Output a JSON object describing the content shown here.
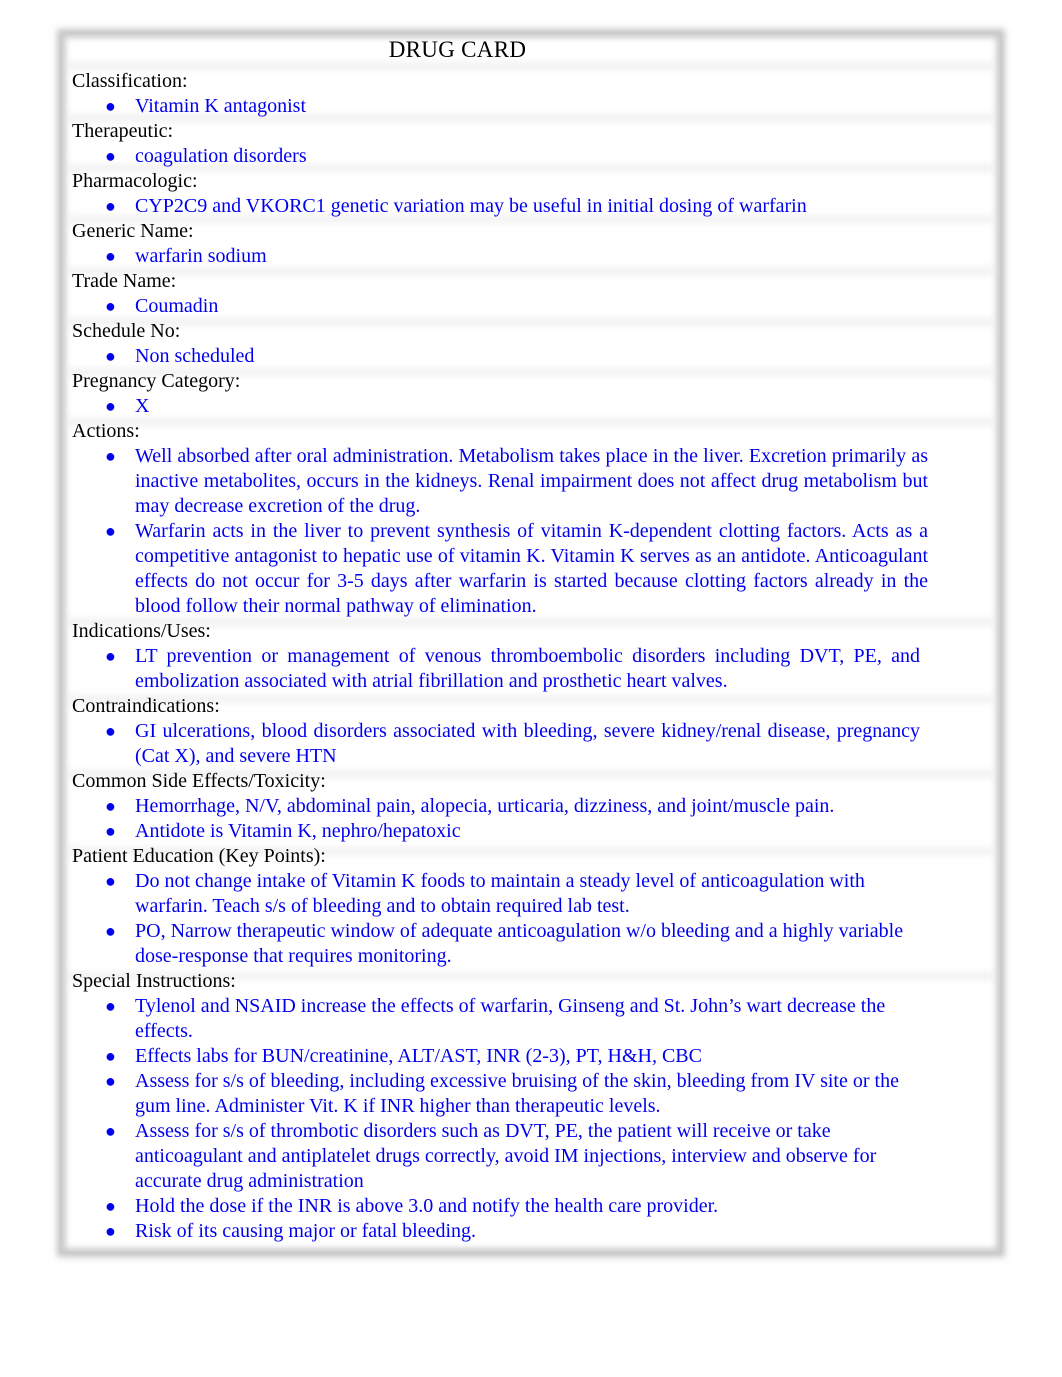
{
  "title": "DRUG CARD",
  "sections": [
    {
      "label": "Classification:",
      "items": [
        "Vitamin K antagonist"
      ]
    },
    {
      "label": "Therapeutic:",
      "items": [
        "coagulation disorders"
      ]
    },
    {
      "label": "Pharmacologic:",
      "items": [
        "CYP2C9 and VKORC1 genetic variation may be useful in initial dosing of warfarin"
      ]
    },
    {
      "label": "Generic Name:",
      "items": [
        "warfarin sodium"
      ]
    },
    {
      "label": "Trade Name:",
      "items": [
        "Coumadin"
      ]
    },
    {
      "label": "Schedule No:",
      "items": [
        "Non scheduled"
      ]
    },
    {
      "label": "Pregnancy Category:",
      "items": [
        "X"
      ]
    },
    {
      "label": "Actions:",
      "items": [
        "Well absorbed after oral administration. Metabolism takes place in the liver. Excretion primarily as inactive metabolites, occurs in the kidneys. Renal impairment does not affect drug metabolism but may decrease excretion of the drug.",
        "Warfarin acts in the liver to prevent synthesis of vitamin K-dependent clotting factors. Acts as a competitive antagonist to hepatic use of vitamin K. Vitamin K serves as an antidote. Anticoagulant effects do not occur for 3-5 days after warfarin is started because clotting factors already in the blood follow their normal pathway of elimination."
      ]
    },
    {
      "label": "Indications/Uses:",
      "items": [
        "LT prevention or management of venous thromboembolic disorders including DVT, PE, and embolization associated with atrial fibrillation and prosthetic heart valves."
      ]
    },
    {
      "label": "Contraindications:",
      "items": [
        "GI ulcerations, blood disorders associated with bleeding, severe kidney/renal disease, pregnancy (Cat X), and severe HTN"
      ]
    },
    {
      "label": "Common Side Effects/Toxicity:",
      "items": [
        "Hemorrhage, N/V, abdominal pain, alopecia, urticaria, dizziness, and joint/muscle pain.",
        "Antidote is Vitamin K, nephro/hepatoxic"
      ]
    },
    {
      "label": "Patient Education (Key Points):",
      "items": [
        "Do not change intake of Vitamin K foods to maintain a steady level of anticoagulation with warfarin. Teach s/s of bleeding and to obtain required lab test.",
        "PO, Narrow therapeutic window of adequate anticoagulation w/o bleeding and a highly variable dose-response that requires monitoring."
      ]
    },
    {
      "label": "Special Instructions:",
      "items": [
        "Tylenol and NSAID increase the effects of warfarin, Ginseng and St. John’s wart decrease the effects.",
        "Effects labs for BUN/creatinine, ALT/AST, INR (2-3), PT, H&H, CBC",
        "Assess for s/s of bleeding, including excessive bruising of the skin, bleeding from IV site or the gum line. Administer Vit. K if INR higher than therapeutic levels.",
        "Assess for s/s of thrombotic disorders such as DVT, PE, the patient will receive or take anticoagulant and antiplatelet drugs correctly, avoid IM injections, interview and observe for accurate drug administration",
        "Hold the dose if the INR is above 3.0 and notify the health care provider.",
        "Risk of its causing major or fatal bleeding."
      ]
    }
  ]
}
